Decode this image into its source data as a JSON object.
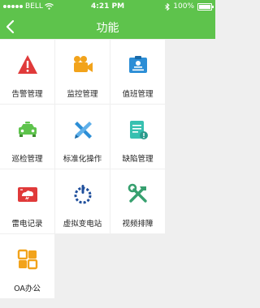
{
  "status_bar": {
    "carrier": "BELL",
    "time": "4:21 PM",
    "battery": "100%"
  },
  "nav": {
    "title": "功能"
  },
  "functions": [
    {
      "label": "告警管理",
      "icon": "alarm-warning-icon",
      "color": "#e03a3a"
    },
    {
      "label": "监控管理",
      "icon": "camera-icon",
      "color": "#f2a31b"
    },
    {
      "label": "值班管理",
      "icon": "id-card-icon",
      "color": "#2c8ed6"
    },
    {
      "label": "巡检管理",
      "icon": "patrol-car-icon",
      "color": "#5ec34c"
    },
    {
      "label": "标准化操作",
      "icon": "ruler-pencil-icon",
      "color": "#2c8ed6"
    },
    {
      "label": "缺陷管理",
      "icon": "defect-document-icon",
      "color": "#37c0b0"
    },
    {
      "label": "雷电记录",
      "icon": "lightning-record-icon",
      "color": "#e03a3a"
    },
    {
      "label": "虚拟变电站",
      "icon": "power-icon",
      "color": "#1f4f9c"
    },
    {
      "label": "视频排障",
      "icon": "tools-icon",
      "color": "#37a06f"
    },
    {
      "label": "OA办公",
      "icon": "oa-grid-icon",
      "color": "#f2a31b"
    }
  ]
}
